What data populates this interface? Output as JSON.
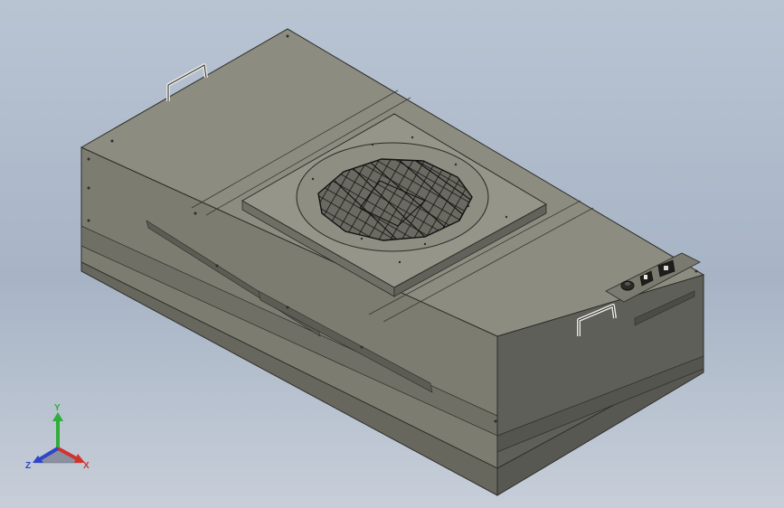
{
  "viewport": {
    "background_top": "#b9c4d3",
    "background_bottom": "#c7ced9"
  },
  "model": {
    "object": "fan-filter-unit",
    "body_color": "#8a8a7c",
    "side_color": "#6e6e64",
    "grille": "fan-grille-icon",
    "handles": [
      "handle-icon",
      "handle-icon"
    ],
    "control_panel": [
      "knob-icon",
      "switch-icon",
      "power-socket-icon"
    ]
  },
  "triad": {
    "y_label": "Y",
    "x_label": "X",
    "z_label": "Z",
    "y_color": "#2fae3a",
    "x_color": "#d0342c",
    "z_color": "#2e45c8"
  }
}
